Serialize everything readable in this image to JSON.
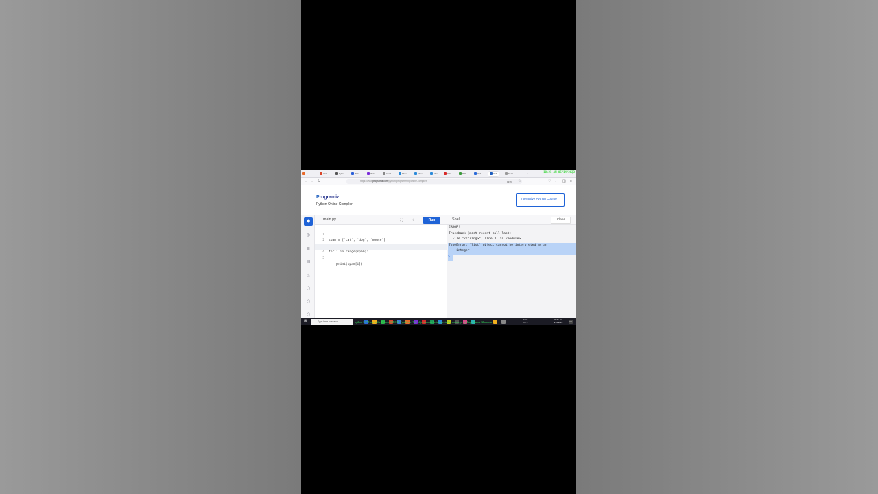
{
  "overlay": {
    "clock": "10:21 AM 05/14/2023"
  },
  "browser": {
    "tabs": [
      {
        "label": "Wel",
        "color": "#d9472b"
      },
      {
        "label": "Pytho",
        "color": "#555"
      },
      {
        "label": "Welc",
        "color": "#2b5fd9"
      },
      {
        "label": "Welc",
        "color": "#7a2bd9"
      },
      {
        "label": "Instal",
        "color": "#888"
      },
      {
        "label": "Thon",
        "color": "#2b8ad9"
      },
      {
        "label": "Thon",
        "color": "#2b8ad9"
      },
      {
        "label": "Thon",
        "color": "#2b8ad9"
      },
      {
        "label": "Vide",
        "color": "#d92b2b"
      },
      {
        "label": "Pyth",
        "color": "#3a9a3a"
      },
      {
        "label": "Onli",
        "color": "#2b6bd9"
      },
      {
        "label": "O",
        "color": "#1f5fbf"
      },
      {
        "label": "St Cl",
        "color": "#999"
      }
    ],
    "url_prefix": "https://www.",
    "url_host": "programiz.com",
    "url_path": "/python-programming/online-compiler/",
    "zoom": "133%"
  },
  "site": {
    "logo_p": "P",
    "logo_rest": "rogramiz",
    "subtitle": "Python Online Compiler",
    "course_button": "Interactive Python Course"
  },
  "editor": {
    "filename": "main.py",
    "run_label": "Run",
    "lines": [
      {
        "num": "1",
        "text": "spam = ['cat', 'dog', 'mouse']"
      },
      {
        "num": "2",
        "text": ""
      },
      {
        "num": "3",
        "text": "for i in range(spam):"
      },
      {
        "num": "4",
        "text": ""
      },
      {
        "num": "5",
        "text": "    print(spam[i])"
      }
    ]
  },
  "shell": {
    "label": "Shell",
    "clear_label": "Clear",
    "output": [
      "ERROR!",
      "Traceback (most recent call last):",
      "  File \"<string>\", line 3, in <module>",
      "TypeError: 'list' object cannot be interpreted as an",
      "    integer",
      ">"
    ]
  },
  "taskbar": {
    "search_placeholder": "Type here to search",
    "tray_lang": "ENG",
    "tray_region": "INTL",
    "time": "10:21 AM",
    "date": "5/14/2023"
  },
  "ticker": "python 3.0*  How to fix Python ERROR: TypeError: 'list' object cannot be interpreted as an integer by Eng. Osama Ghandour"
}
